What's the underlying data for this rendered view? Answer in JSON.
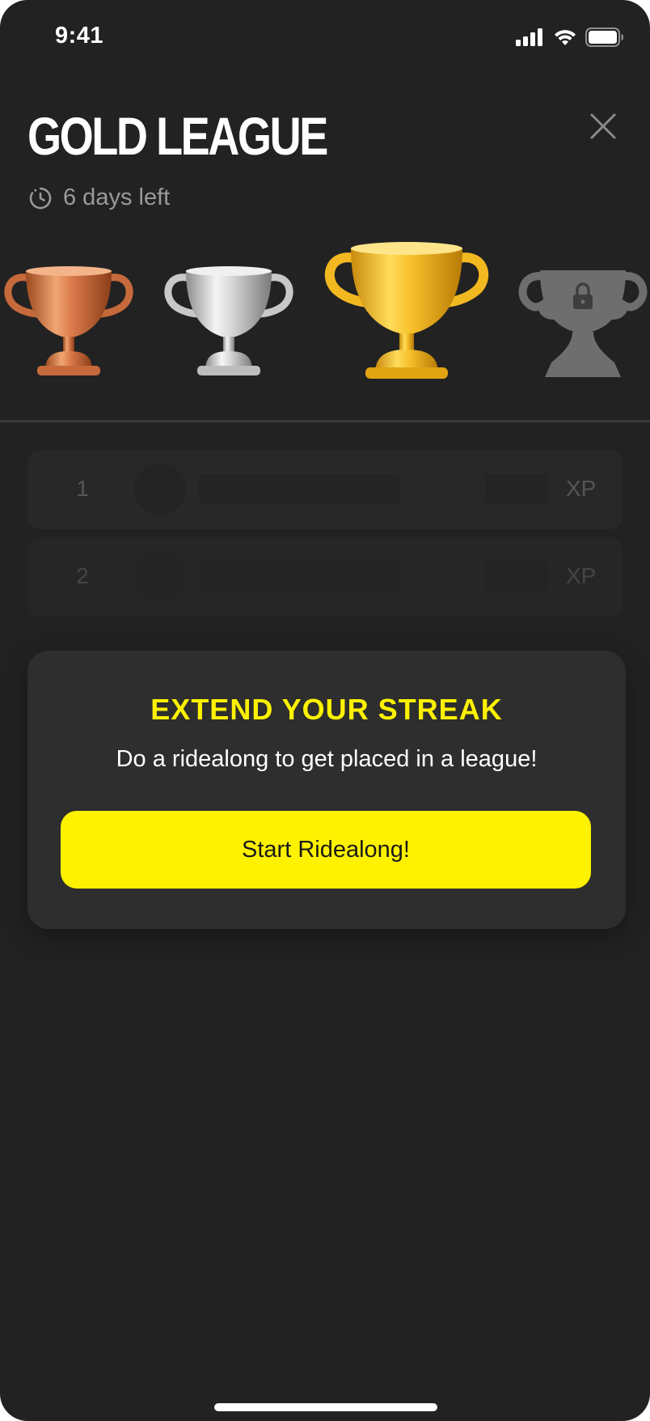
{
  "status_bar": {
    "time": "9:41",
    "icons": [
      "signal-icon",
      "wifi-icon",
      "battery-icon"
    ]
  },
  "header": {
    "title": "GOLD LEAGUE",
    "time_left": "6 days left",
    "timer_icon": "clock-icon",
    "close_icon": "close-icon"
  },
  "trophies": [
    {
      "name": "bronze",
      "locked": false
    },
    {
      "name": "silver",
      "locked": false
    },
    {
      "name": "gold",
      "locked": false,
      "current": true
    },
    {
      "name": "locked",
      "locked": true
    }
  ],
  "leaderboard": {
    "rows": [
      {
        "rank": "1",
        "xp_label": "XP"
      },
      {
        "rank": "2",
        "xp_label": "XP"
      }
    ]
  },
  "streak_card": {
    "title": "EXTEND YOUR STREAK",
    "subtitle": "Do a ridealong to get placed in a league!",
    "button_label": "Start Ridealong!"
  },
  "colors": {
    "background": "#222222",
    "accent": "#fff200",
    "card": "#2e2e2e",
    "muted_text": "#9a9a9a"
  }
}
